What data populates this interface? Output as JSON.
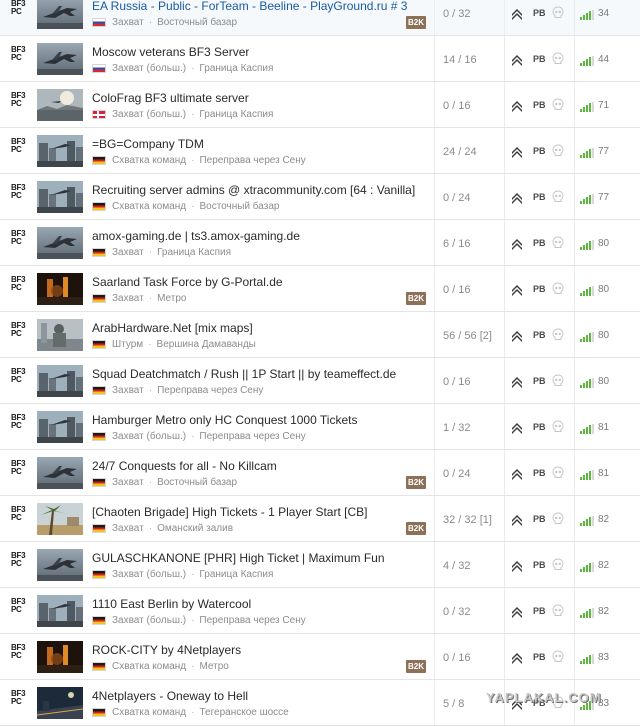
{
  "accent_colors": {
    "ping_bars": "#5cb83c",
    "b2k_badge": "#8d7058",
    "text": "#2a2a2a",
    "muted": "#8c8c8c"
  },
  "servers": [
    {
      "game": [
        "BF3",
        "PC"
      ],
      "thumb": "jet",
      "name": "EA Russia - Public - ForTeam - Beeline - PlayGround.ru # 3",
      "flag": "ru",
      "mode": "Захват",
      "map": "Восточный базар",
      "b2k": "B2K",
      "players": "0 / 32",
      "pb": "PB",
      "ping": "34"
    },
    {
      "game": [
        "BF3",
        "PC"
      ],
      "thumb": "jet",
      "name": "Moscow veterans BF3 Server",
      "flag": "ru",
      "mode": "Захват (больш.)",
      "map": "Граница Каспия",
      "b2k": "",
      "players": "14 / 16",
      "pb": "PB",
      "ping": "44"
    },
    {
      "game": [
        "BF3",
        "PC"
      ],
      "thumb": "sunrise",
      "name": "ColoFrag BF3 ultimate server",
      "flag": "dk",
      "mode": "Захват (больш.)",
      "map": "Граница Каспия",
      "b2k": "",
      "players": "0 / 16",
      "pb": "PB",
      "ping": "71"
    },
    {
      "game": [
        "BF3",
        "PC"
      ],
      "thumb": "city",
      "name": "=BG=Company TDM",
      "flag": "de",
      "mode": "Схватка команд",
      "map": "Переправа через Сену",
      "b2k": "",
      "players": "24 / 24",
      "pb": "PB",
      "ping": "77"
    },
    {
      "game": [
        "BF3",
        "PC"
      ],
      "thumb": "city",
      "name": "Recruiting server admins @ xtracommunity.com [64 : Vanilla]",
      "flag": "de",
      "mode": "Схватка команд",
      "map": "Восточный базар",
      "b2k": "",
      "players": "0 / 24",
      "pb": "PB",
      "ping": "77"
    },
    {
      "game": [
        "BF3",
        "PC"
      ],
      "thumb": "jet",
      "name": "amox-gaming.de | ts3.amox-gaming.de",
      "flag": "de",
      "mode": "Захват",
      "map": "Граница Каспия",
      "b2k": "",
      "players": "6 / 16",
      "pb": "PB",
      "ping": "80"
    },
    {
      "game": [
        "BF3",
        "PC"
      ],
      "thumb": "metro",
      "name": "Saarland Task Force by G-Portal.de",
      "flag": "de",
      "mode": "Захват",
      "map": "Метро",
      "b2k": "B2K",
      "players": "0 / 16",
      "pb": "PB",
      "ping": "80"
    },
    {
      "game": [
        "BF3",
        "PC"
      ],
      "thumb": "soldier",
      "name": "ArabHardware.Net [mix maps]",
      "flag": "de",
      "mode": "Штурм",
      "map": "Вершина Дамаванды",
      "b2k": "",
      "players": "56 / 56 [2]",
      "pb": "PB",
      "ping": "80"
    },
    {
      "game": [
        "BF3",
        "PC"
      ],
      "thumb": "city",
      "name": "Squad Deatchmatch / Rush || 1P Start || by teameffect.de",
      "flag": "de",
      "mode": "Захват",
      "map": "Переправа через Сену",
      "b2k": "",
      "players": "0 / 16",
      "pb": "PB",
      "ping": "80"
    },
    {
      "game": [
        "BF3",
        "PC"
      ],
      "thumb": "city",
      "name": "Hamburger Metro only HC Conquest 1000 Tickets",
      "flag": "de",
      "mode": "Захват (больш.)",
      "map": "Переправа через Сену",
      "b2k": "",
      "players": "1 / 32",
      "pb": "PB",
      "ping": "81"
    },
    {
      "game": [
        "BF3",
        "PC"
      ],
      "thumb": "jet",
      "name": "24/7 Conquests for all - No Killcam",
      "flag": "de",
      "mode": "Захват",
      "map": "Восточный базар",
      "b2k": "B2K",
      "players": "0 / 24",
      "pb": "PB",
      "ping": "81"
    },
    {
      "game": [
        "BF3",
        "PC"
      ],
      "thumb": "palm",
      "name": "[Chaoten Brigade] High Tickets - 1 Player Start [CB]",
      "flag": "de",
      "mode": "Захват",
      "map": "Оманский залив",
      "b2k": "B2K",
      "players": "32 / 32 [1]",
      "pb": "PB",
      "ping": "82"
    },
    {
      "game": [
        "BF3",
        "PC"
      ],
      "thumb": "jet",
      "name": "GULASCHKANONE [PHR] High Ticket | Maximum Fun",
      "flag": "de",
      "mode": "Захват (больш.)",
      "map": "Граница Каспия",
      "b2k": "",
      "players": "4 / 32",
      "pb": "PB",
      "ping": "82"
    },
    {
      "game": [
        "BF3",
        "PC"
      ],
      "thumb": "city",
      "name": "1110 East Berlin by Watercool",
      "flag": "de",
      "mode": "Захват (больш.)",
      "map": "Переправа через Сену",
      "b2k": "",
      "players": "0 / 32",
      "pb": "PB",
      "ping": "82"
    },
    {
      "game": [
        "BF3",
        "PC"
      ],
      "thumb": "metro",
      "name": "ROCK-CITY by 4Netplayers",
      "flag": "de",
      "mode": "Схватка команд",
      "map": "Метро",
      "b2k": "B2K",
      "players": "0 / 16",
      "pb": "PB",
      "ping": "83"
    },
    {
      "game": [
        "BF3",
        "PC"
      ],
      "thumb": "tehran",
      "name": "4Netplayers - Oneway to Hell",
      "flag": "de",
      "mode": "Схватка команд",
      "map": "Тегеранское шоссе",
      "b2k": "",
      "players": "5 / 8",
      "pb": "PB",
      "ping": "83"
    }
  ],
  "watermark": "YAPLAKAL.COM"
}
